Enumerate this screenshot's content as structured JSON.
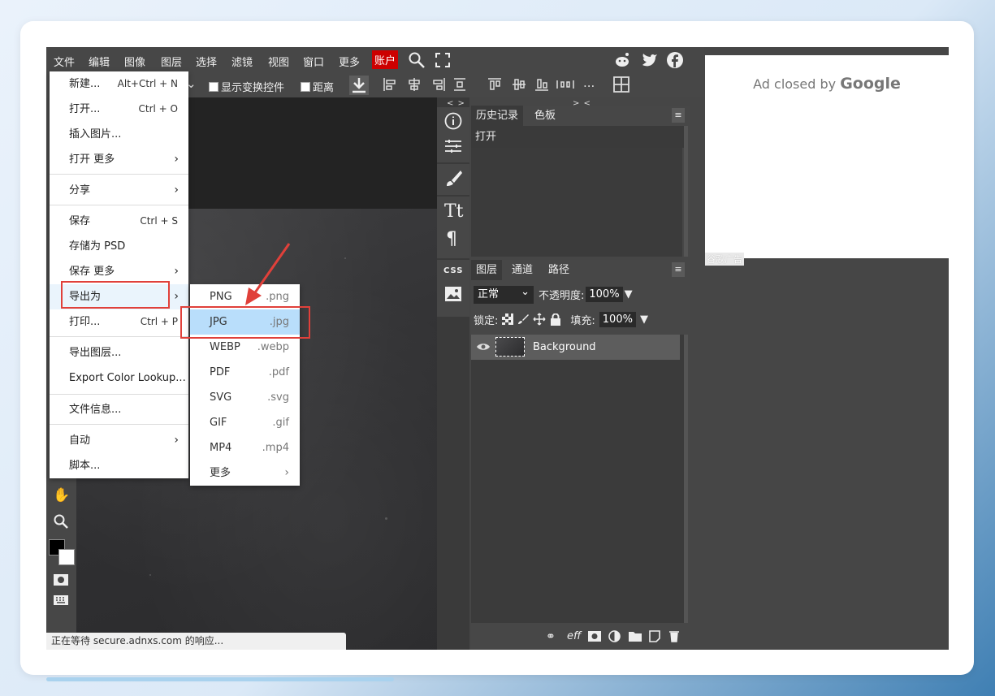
{
  "menubar": {
    "items": [
      "文件",
      "编辑",
      "图像",
      "图层",
      "选择",
      "滤镜",
      "视图",
      "窗口",
      "更多"
    ],
    "account": "账户"
  },
  "toolbar": {
    "show_transform": "显示变换控件",
    "distance": "距离",
    "more": "..."
  },
  "file_menu": {
    "items": [
      {
        "label": "新建...",
        "shortcut": "Alt+Ctrl + N"
      },
      {
        "label": "打开...",
        "shortcut": "Ctrl + O"
      },
      {
        "label": "插入图片...",
        "shortcut": ""
      },
      {
        "label": "打开 更多",
        "shortcut": ""
      },
      {
        "label": "分享",
        "shortcut": ""
      },
      {
        "label": "保存",
        "shortcut": "Ctrl + S"
      },
      {
        "label": "存储为 PSD",
        "shortcut": ""
      },
      {
        "label": "保存 更多",
        "shortcut": ""
      },
      {
        "label": "导出为",
        "shortcut": ""
      },
      {
        "label": "打印...",
        "shortcut": "Ctrl + P"
      },
      {
        "label": "导出图层...",
        "shortcut": ""
      },
      {
        "label": "Export Color Lookup...",
        "shortcut": ""
      },
      {
        "label": "文件信息...",
        "shortcut": ""
      },
      {
        "label": "自动",
        "shortcut": ""
      },
      {
        "label": "脚本...",
        "shortcut": ""
      }
    ]
  },
  "export_menu": {
    "items": [
      {
        "label": "PNG",
        "ext": ".png"
      },
      {
        "label": "JPG",
        "ext": ".jpg"
      },
      {
        "label": "WEBP",
        "ext": ".webp"
      },
      {
        "label": "PDF",
        "ext": ".pdf"
      },
      {
        "label": "SVG",
        "ext": ".svg"
      },
      {
        "label": "GIF",
        "ext": ".gif"
      },
      {
        "label": "MP4",
        "ext": ".mp4"
      },
      {
        "label": "更多",
        "ext": ""
      }
    ],
    "selected": "JPG"
  },
  "history_panel": {
    "tabs": [
      "历史记录",
      "色板"
    ],
    "entries": [
      "打开"
    ]
  },
  "layers_panel": {
    "tabs": [
      "图层",
      "通道",
      "路径"
    ],
    "blend_mode": "正常",
    "opacity_label": "不透明度:",
    "opacity": "100%",
    "lock_label": "锁定:",
    "fill_label": "填充:",
    "fill": "100%",
    "layers": [
      "Background"
    ]
  },
  "iconbar": {
    "css_label": "CSS",
    "collapse_left": "< >",
    "collapse_right": "> <"
  },
  "ad": {
    "text": "Ad closed by",
    "brand": "Google",
    "label": "谷歌广告"
  },
  "status": "正在等待 secure.adnxs.com 的响应...",
  "colors": {
    "accent_account": "#cc0000",
    "highlight_box": "#e0403a",
    "selected_item": "#b9defb"
  }
}
